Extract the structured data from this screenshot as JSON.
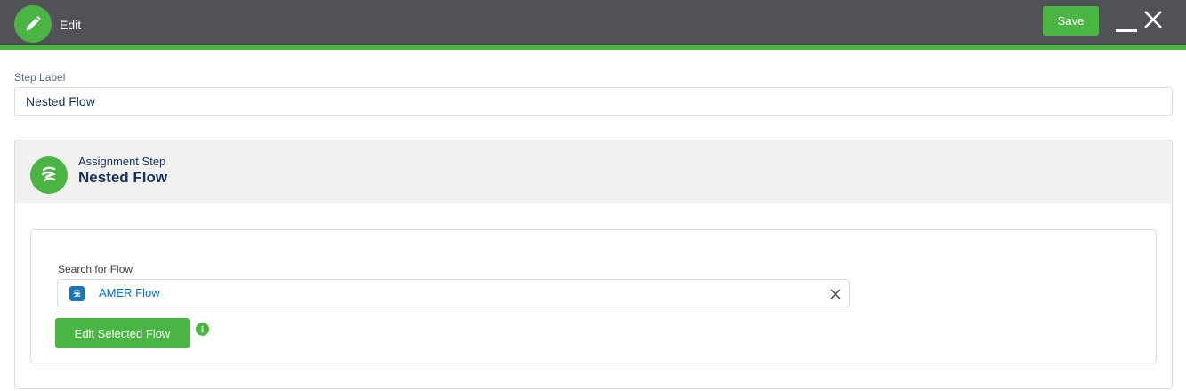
{
  "header": {
    "title": "Edit",
    "save_label": "Save",
    "icon": "pencil-icon",
    "accent_color": "#4bb543",
    "background_color": "#505257"
  },
  "step_label": {
    "label": "Step Label",
    "value": "Nested Flow"
  },
  "card": {
    "icon": "flow-icon",
    "subtitle": "Assignment Step",
    "title": "Nested Flow",
    "search": {
      "label": "Search for Flow",
      "selected_value": "AMER Flow",
      "selected_icon": "flow-icon",
      "clear_icon": "close-icon"
    },
    "edit_button_label": "Edit Selected Flow",
    "info_icon": "info-icon"
  }
}
